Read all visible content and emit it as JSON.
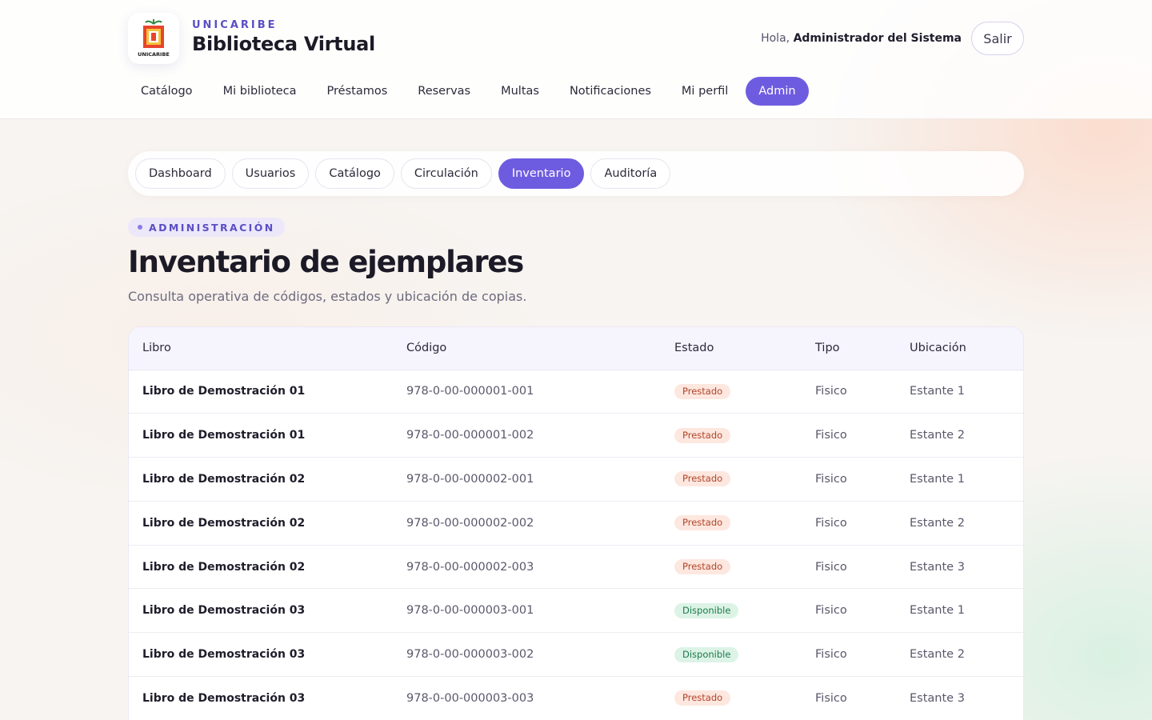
{
  "brand": {
    "subtitle": "UNICARIBE",
    "title": "Biblioteca Virtual",
    "logo_text": "UNICARIBE"
  },
  "user": {
    "greeting": "Hola,",
    "name": "Administrador del Sistema",
    "logout_label": "Salir"
  },
  "main_nav": [
    {
      "label": "Catálogo",
      "active": false
    },
    {
      "label": "Mi biblioteca",
      "active": false
    },
    {
      "label": "Préstamos",
      "active": false
    },
    {
      "label": "Reservas",
      "active": false
    },
    {
      "label": "Multas",
      "active": false
    },
    {
      "label": "Notificaciones",
      "active": false
    },
    {
      "label": "Mi perfil",
      "active": false
    },
    {
      "label": "Admin",
      "active": true
    }
  ],
  "admin_tabs": [
    {
      "label": "Dashboard",
      "active": false
    },
    {
      "label": "Usuarios",
      "active": false
    },
    {
      "label": "Catálogo",
      "active": false
    },
    {
      "label": "Circulación",
      "active": false
    },
    {
      "label": "Inventario",
      "active": true
    },
    {
      "label": "Auditoría",
      "active": false
    }
  ],
  "section": {
    "eyebrow": "ADMINISTRACIÓN",
    "title": "Inventario de ejemplares",
    "description": "Consulta operativa de códigos, estados y ubicación de copias."
  },
  "table": {
    "headers": [
      "Libro",
      "Código",
      "Estado",
      "Tipo",
      "Ubicación"
    ],
    "rows": [
      {
        "book": "Libro de Demostración 01",
        "code": "978-0-00-000001-001",
        "status": "Prestado",
        "type": "Fisico",
        "location": "Estante 1"
      },
      {
        "book": "Libro de Demostración 01",
        "code": "978-0-00-000001-002",
        "status": "Prestado",
        "type": "Fisico",
        "location": "Estante 2"
      },
      {
        "book": "Libro de Demostración 02",
        "code": "978-0-00-000002-001",
        "status": "Prestado",
        "type": "Fisico",
        "location": "Estante 1"
      },
      {
        "book": "Libro de Demostración 02",
        "code": "978-0-00-000002-002",
        "status": "Prestado",
        "type": "Fisico",
        "location": "Estante 2"
      },
      {
        "book": "Libro de Demostración 02",
        "code": "978-0-00-000002-003",
        "status": "Prestado",
        "type": "Fisico",
        "location": "Estante 3"
      },
      {
        "book": "Libro de Demostración 03",
        "code": "978-0-00-000003-001",
        "status": "Disponible",
        "type": "Fisico",
        "location": "Estante 1"
      },
      {
        "book": "Libro de Demostración 03",
        "code": "978-0-00-000003-002",
        "status": "Disponible",
        "type": "Fisico",
        "location": "Estante 2"
      },
      {
        "book": "Libro de Demostración 03",
        "code": "978-0-00-000003-003",
        "status": "Prestado",
        "type": "Fisico",
        "location": "Estante 3"
      }
    ]
  },
  "colors": {
    "accent": "#6e5ce0",
    "status_prestado": "#b0452a",
    "status_disponible": "#1d7a4c"
  }
}
